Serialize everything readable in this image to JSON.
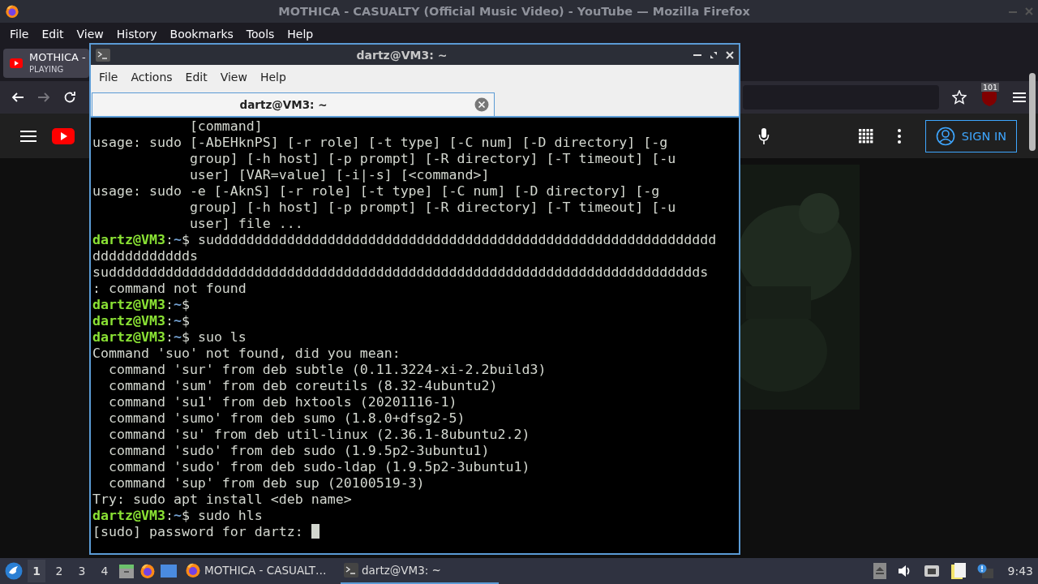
{
  "browser": {
    "title": "MOTHICA - CASUALTY (Official Music Video) - YouTube — Mozilla Firefox",
    "menu": [
      "File",
      "Edit",
      "View",
      "History",
      "Bookmarks",
      "Tools",
      "Help"
    ],
    "tab": {
      "title": "MOTHICA -",
      "subtitle": "PLAYING"
    },
    "extension_badge": "101",
    "sign_in": "SIGN IN"
  },
  "terminal": {
    "title": "dartz@VM3: ~",
    "menu": [
      "File",
      "Actions",
      "Edit",
      "View",
      "Help"
    ],
    "tab": {
      "title": "dartz@VM3: ~",
      "selected": true
    },
    "lines": [
      {
        "spans": [
          {
            "kind": "plain",
            "text": "            [command]"
          }
        ]
      },
      {
        "spans": [
          {
            "kind": "plain",
            "text": "usage: sudo [-AbEHknPS] [-r role] [-t type] [-C num] [-D directory] [-g"
          }
        ]
      },
      {
        "spans": [
          {
            "kind": "plain",
            "text": "            group] [-h host] [-p prompt] [-R directory] [-T timeout] [-u"
          }
        ]
      },
      {
        "spans": [
          {
            "kind": "plain",
            "text": "            user] [VAR=value] [-i|-s] [<command>]"
          }
        ]
      },
      {
        "spans": [
          {
            "kind": "plain",
            "text": "usage: sudo -e [-AknS] [-r role] [-t type] [-C num] [-D directory] [-g"
          }
        ]
      },
      {
        "spans": [
          {
            "kind": "plain",
            "text": "            group] [-h host] [-p prompt] [-R directory] [-T timeout] [-u"
          }
        ]
      },
      {
        "spans": [
          {
            "kind": "plain",
            "text": "            user] file ..."
          }
        ]
      },
      {
        "spans": [
          {
            "kind": "user",
            "text": "dartz@VM3"
          },
          {
            "kind": "plain",
            "text": ":"
          },
          {
            "kind": "path",
            "text": "~"
          },
          {
            "kind": "plain",
            "text": "$ sudddddddddddddddddddddddddddddddddddddddddddddddddddddddddddddd"
          }
        ]
      },
      {
        "spans": [
          {
            "kind": "plain",
            "text": "dddddddddddds"
          }
        ]
      },
      {
        "spans": [
          {
            "kind": "plain",
            "text": "suddddddddddddddddddddddddddddddddddddddddddddddddddddddddddddddddddddddddds"
          }
        ]
      },
      {
        "spans": [
          {
            "kind": "plain",
            "text": ": command not found"
          }
        ]
      },
      {
        "spans": [
          {
            "kind": "user",
            "text": "dartz@VM3"
          },
          {
            "kind": "plain",
            "text": ":"
          },
          {
            "kind": "path",
            "text": "~"
          },
          {
            "kind": "plain",
            "text": "$"
          }
        ]
      },
      {
        "spans": [
          {
            "kind": "user",
            "text": "dartz@VM3"
          },
          {
            "kind": "plain",
            "text": ":"
          },
          {
            "kind": "path",
            "text": "~"
          },
          {
            "kind": "plain",
            "text": "$"
          }
        ]
      },
      {
        "spans": [
          {
            "kind": "user",
            "text": "dartz@VM3"
          },
          {
            "kind": "plain",
            "text": ":"
          },
          {
            "kind": "path",
            "text": "~"
          },
          {
            "kind": "plain",
            "text": "$ suo ls"
          }
        ]
      },
      {
        "spans": [
          {
            "kind": "plain",
            "text": "Command 'suo' not found, did you mean:"
          }
        ]
      },
      {
        "spans": [
          {
            "kind": "plain",
            "text": "  command 'sur' from deb subtle (0.11.3224-xi-2.2build3)"
          }
        ]
      },
      {
        "spans": [
          {
            "kind": "plain",
            "text": "  command 'sum' from deb coreutils (8.32-4ubuntu2)"
          }
        ]
      },
      {
        "spans": [
          {
            "kind": "plain",
            "text": "  command 'su1' from deb hxtools (20201116-1)"
          }
        ]
      },
      {
        "spans": [
          {
            "kind": "plain",
            "text": "  command 'sumo' from deb sumo (1.8.0+dfsg2-5)"
          }
        ]
      },
      {
        "spans": [
          {
            "kind": "plain",
            "text": "  command 'su' from deb util-linux (2.36.1-8ubuntu2.2)"
          }
        ]
      },
      {
        "spans": [
          {
            "kind": "plain",
            "text": "  command 'sudo' from deb sudo (1.9.5p2-3ubuntu1)"
          }
        ]
      },
      {
        "spans": [
          {
            "kind": "plain",
            "text": "  command 'sudo' from deb sudo-ldap (1.9.5p2-3ubuntu1)"
          }
        ]
      },
      {
        "spans": [
          {
            "kind": "plain",
            "text": "  command 'sup' from deb sup (20100519-3)"
          }
        ]
      },
      {
        "spans": [
          {
            "kind": "plain",
            "text": "Try: sudo apt install <deb name>"
          }
        ]
      },
      {
        "spans": [
          {
            "kind": "user",
            "text": "dartz@VM3"
          },
          {
            "kind": "plain",
            "text": ":"
          },
          {
            "kind": "path",
            "text": "~"
          },
          {
            "kind": "plain",
            "text": "$ sudo hls"
          }
        ]
      },
      {
        "spans": [
          {
            "kind": "plain",
            "text": "[sudo] password for dartz: "
          }
        ],
        "cursor": true
      }
    ]
  },
  "taskbar": {
    "workspaces": [
      {
        "label": "1",
        "selected": true
      },
      {
        "label": "2",
        "selected": false
      },
      {
        "label": "3",
        "selected": false
      },
      {
        "label": "4",
        "selected": false
      }
    ],
    "tasks": [
      {
        "kind": "browser",
        "label": "MOTHICA - CASUALT…",
        "selected": false
      },
      {
        "kind": "terminal",
        "label": "dartz@VM3: ~",
        "selected": true
      }
    ],
    "clock": "9:43"
  }
}
